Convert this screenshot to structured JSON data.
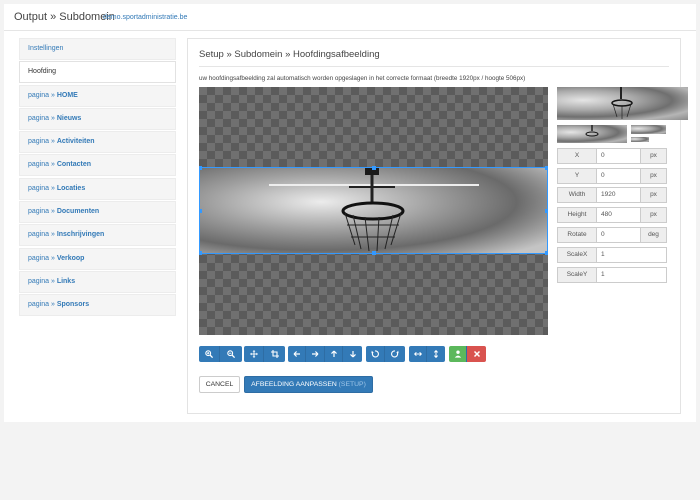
{
  "header": {
    "title": "Output » Subdomein",
    "domain": "demo.sportadministratie.be"
  },
  "sidebar": {
    "items": [
      {
        "label": "Instellingen",
        "prefix": "",
        "active": false
      },
      {
        "label": "Hoofding",
        "prefix": "",
        "active": true
      },
      {
        "prefix": "pagina » ",
        "label": "HOME"
      },
      {
        "prefix": "pagina » ",
        "label": "Nieuws"
      },
      {
        "prefix": "pagina » ",
        "label": "Activiteiten"
      },
      {
        "prefix": "pagina » ",
        "label": "Contacten"
      },
      {
        "prefix": "pagina » ",
        "label": "Locaties"
      },
      {
        "prefix": "pagina » ",
        "label": "Documenten"
      },
      {
        "prefix": "pagina » ",
        "label": "Inschrijvingen"
      },
      {
        "prefix": "pagina » ",
        "label": "Verkoop"
      },
      {
        "prefix": "pagina » ",
        "label": "Links"
      },
      {
        "prefix": "pagina » ",
        "label": "Sponsors"
      }
    ]
  },
  "panel": {
    "title": "Setup » Subdomein » Hoofdingsafbeelding",
    "info": "uw hoofdingsafbeelding zal automatisch worden opgeslagen in het correcte formaat (breedte 1920px / hoogte 506px)"
  },
  "fields": [
    {
      "label": "X",
      "value": "0",
      "unit": "px"
    },
    {
      "label": "Y",
      "value": "0",
      "unit": "px"
    },
    {
      "label": "Width",
      "value": "1920",
      "unit": "px"
    },
    {
      "label": "Height",
      "value": "480",
      "unit": "px"
    },
    {
      "label": "Rotate",
      "value": "0",
      "unit": "deg"
    },
    {
      "label": "ScaleX",
      "value": "1",
      "unit": ""
    },
    {
      "label": "ScaleY",
      "value": "1",
      "unit": ""
    }
  ],
  "toolbar": {
    "zoom_in": "zoom-in-icon",
    "zoom_out": "zoom-out-icon",
    "move": "move-icon",
    "crop": "crop-icon",
    "left": "arrow-left-icon",
    "right": "arrow-right-icon",
    "up": "arrow-up-icon",
    "down": "arrow-down-icon",
    "rotate_left": "rotate-left-icon",
    "rotate_right": "rotate-right-icon",
    "flip_h": "flip-horizontal-icon",
    "flip_v": "flip-vertical-icon",
    "upload": "upload-icon",
    "remove": "remove-icon"
  },
  "actions": {
    "cancel": "CANCEL",
    "apply": "AFBEELDING AANPASSEN",
    "apply_suffix": "(SETUP)"
  },
  "colors": {
    "primary": "#337ab7",
    "success": "#5cb85c",
    "danger": "#d9534f",
    "crop_border": "#3399ff"
  }
}
